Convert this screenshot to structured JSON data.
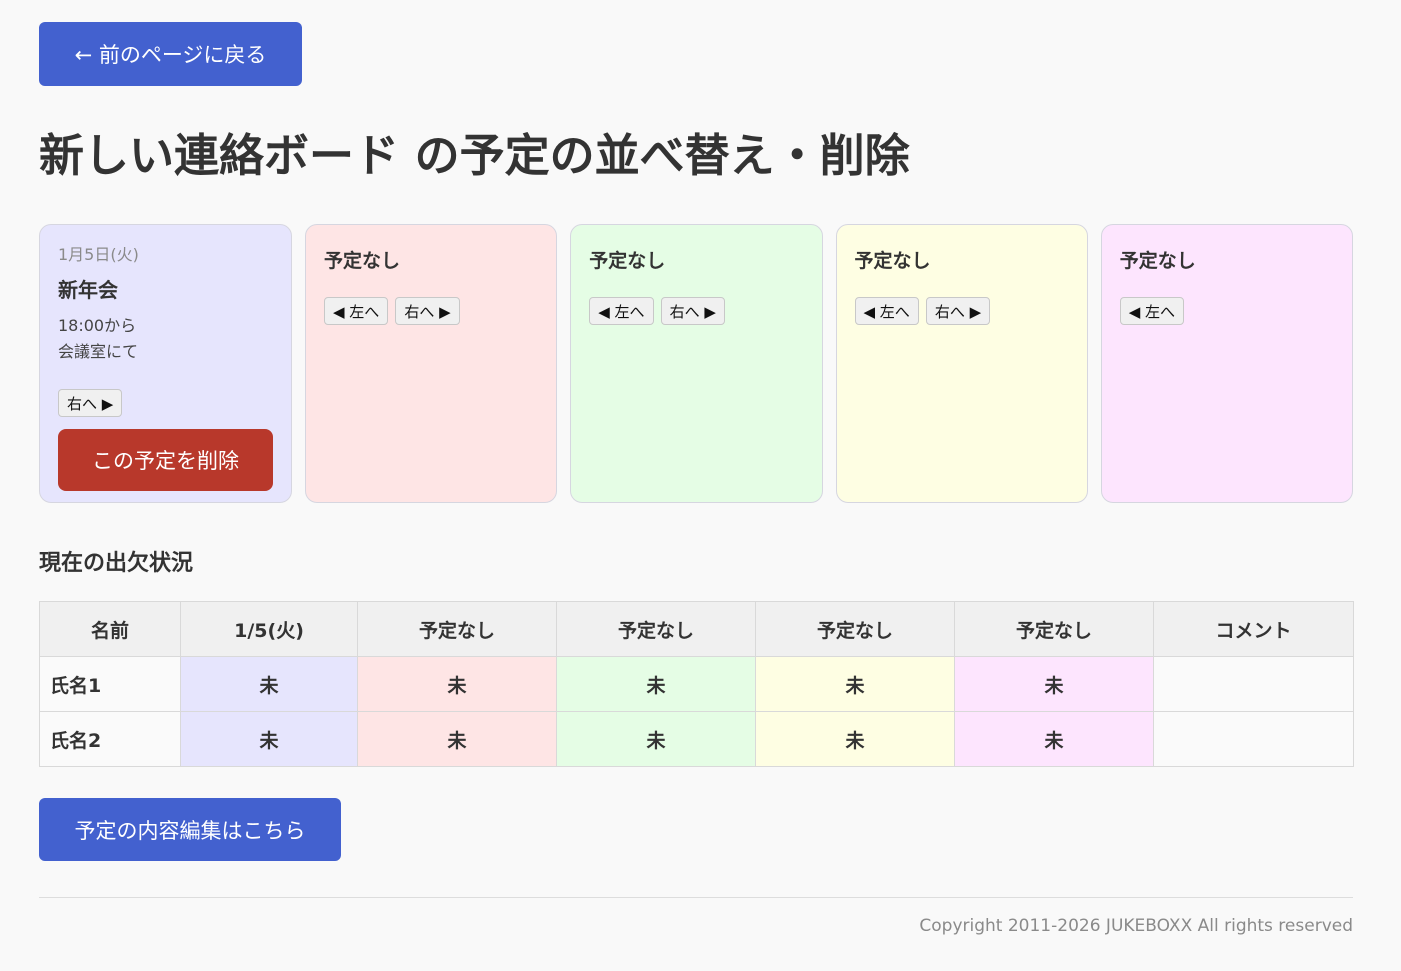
{
  "header": {
    "back_label": "← 前のページに戻る",
    "title": "新しい連絡ボード の予定の並べ替え・削除"
  },
  "slots": [
    {
      "date": "1月5日(火)",
      "name": "新年会",
      "time": "18:00から",
      "place": "会議室にて",
      "right_label": "右へ ▶",
      "delete_label": "この予定を削除",
      "bg": "#e6e5fd"
    },
    {
      "label": "予定なし",
      "left_label": "◀ 左へ",
      "right_label": "右へ ▶",
      "bg": "#fee5e5"
    },
    {
      "label": "予定なし",
      "left_label": "◀ 左へ",
      "right_label": "右へ ▶",
      "bg": "#e5fde5"
    },
    {
      "label": "予定なし",
      "left_label": "◀ 左へ",
      "right_label": "右へ ▶",
      "bg": "#fefee3"
    },
    {
      "label": "予定なし",
      "left_label": "◀ 左へ",
      "bg": "#fde5fe"
    }
  ],
  "attendance": {
    "section_title": "現在の出欠状況",
    "headers": [
      "名前",
      "1/5(火)",
      "予定なし",
      "予定なし",
      "予定なし",
      "予定なし",
      "コメント"
    ],
    "rows": [
      {
        "name": "氏名1",
        "cells": [
          "未",
          "未",
          "未",
          "未",
          "未"
        ],
        "comment": ""
      },
      {
        "name": "氏名2",
        "cells": [
          "未",
          "未",
          "未",
          "未",
          "未"
        ],
        "comment": ""
      }
    ],
    "column_colors": [
      "#e6e5fd",
      "#fee5e5",
      "#e5fde5",
      "#fefee3",
      "#fde5fe"
    ]
  },
  "actions": {
    "edit_label": "予定の内容編集はこちら"
  },
  "footer": {
    "copyright": "Copyright 2011-2026 JUKEBOXX All rights reserved"
  },
  "colors": {
    "primary": "#4361cf",
    "danger": "#b8382b"
  }
}
